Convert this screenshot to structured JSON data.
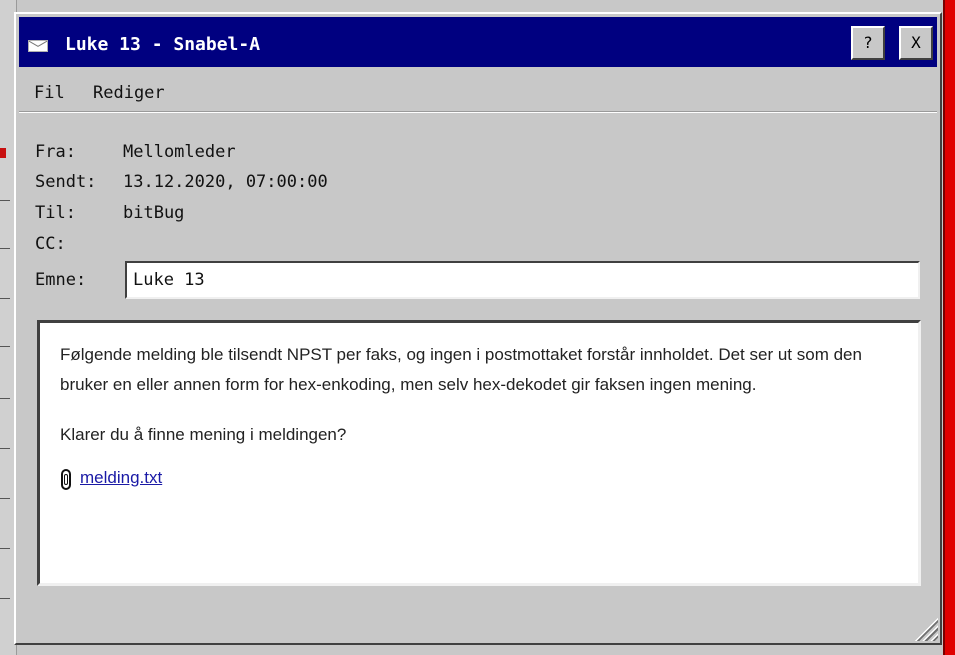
{
  "window": {
    "title": "Luke 13 - Snabel-A",
    "help_label": "?",
    "close_label": "X",
    "icon": "mail-icon"
  },
  "menu": {
    "items": [
      "Fil",
      "Rediger"
    ]
  },
  "header": {
    "from_label": "Fra:",
    "from_value": "Mellomleder",
    "sent_label": "Sendt:",
    "sent_value": "13.12.2020, 07:00:00",
    "to_label": "Til:",
    "to_value": "bitBug",
    "cc_label": "CC:",
    "cc_value": "",
    "subject_label": "Emne:",
    "subject_value": "Luke 13"
  },
  "body": {
    "paragraph1": "Følgende melding ble tilsendt NPST per faks, og ingen i postmottaket forstår innholdet. Det ser ut som den bruker en eller annen form for hex-enkoding, men selv hex-dekodet gir faksen ingen mening.",
    "paragraph2": "Klarer du å finne mening i meldingen?",
    "attachment_name": "melding.txt",
    "attachment_icon": "paperclip-icon"
  },
  "colors": {
    "titlebar": "#000080",
    "window": "#c8c8c8",
    "link": "#1a1aa6",
    "desktop_right": "#e00000"
  }
}
